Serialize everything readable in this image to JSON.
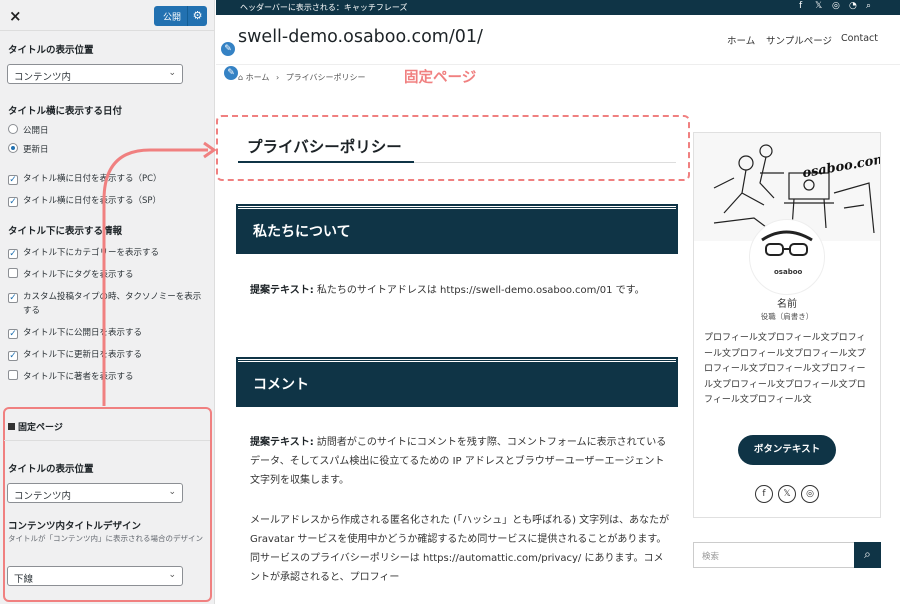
{
  "customizer": {
    "close_icon": "×",
    "publish_label": "公開",
    "gear_icon": "⚙",
    "title_position_heading": "タイトルの表示位置",
    "title_position_value": "コンテンツ内",
    "date_heading": "タイトル横に表示する日付",
    "date_options": [
      "公開日",
      "更新日"
    ],
    "date_selected": "更新日",
    "date_checkboxes": [
      "タイトル横に日付を表示する（PC）",
      "タイトル横に日付を表示する（SP）"
    ],
    "info_heading": "タイトル下に表示する情報",
    "info_checkboxes": [
      {
        "label": "タイトル下にカテゴリーを表示する",
        "checked": true
      },
      {
        "label": "タイトル下にタグを表示する",
        "checked": false
      },
      {
        "label": "カスタム投稿タイプの時、タクソノミーを表示する",
        "checked": true
      },
      {
        "label": "タイトル下に公開日を表示する",
        "checked": true
      },
      {
        "label": "タイトル下に更新日を表示する",
        "checked": true
      },
      {
        "label": "タイトル下に著者を表示する",
        "checked": false
      }
    ],
    "fixed_page_section": "固定ページ",
    "fixed_title_position_heading": "タイトルの表示位置",
    "fixed_title_position_value": "コンテンツ内",
    "fixed_title_design_heading": "コンテンツ内タイトルデザイン",
    "fixed_title_design_desc": "タイトルが「コンテンツ内」に表示される場合のデザイン",
    "fixed_title_design_value": "下線"
  },
  "site": {
    "topbar_text": "ヘッダーバーに表示される：キャッチフレーズ",
    "title": "swell-demo.osaboo.com/01/",
    "nav": [
      "ホーム",
      "サンプルページ",
      "Contact"
    ],
    "breadcrumb_home": "ホーム",
    "breadcrumb_sep": "›",
    "breadcrumb_current": "プライバシーポリシー",
    "annotation_label": "固定ページ",
    "page_title": "プライバシーポリシー",
    "sections": [
      {
        "heading": "私たちについて",
        "paragraphs": [
          {
            "bold": "提案テキスト:",
            "text": " 私たちのサイトアドレスは https://swell-demo.osaboo.com/01 です。"
          }
        ]
      },
      {
        "heading": "コメント",
        "paragraphs": [
          {
            "bold": "提案テキスト:",
            "text": " 訪問者がこのサイトにコメントを残す際、コメントフォームに表示されているデータ、そしてスパム検出に役立てるための IP アドレスとブラウザーユーザーエージェント文字列を収集します。"
          },
          {
            "bold": "",
            "text": "メールアドレスから作成される匿名化された (「ハッシュ」とも呼ばれる) 文字列は、あなたが Gravatar サービスを使用中かどうか確認するため同サービスに提供されることがあります。同サービスのプライバシーポリシーは https://automattic.com/privacy/ にあります。コメントが承認されると、プロフィー"
          }
        ]
      }
    ]
  },
  "widget": {
    "image_text": "osaboo.com",
    "avatar_text": "osaboo",
    "name": "名前",
    "role": "役職（肩書き）",
    "profile_text": "プロフィール文プロフィール文プロフィール文プロフィール文プロフィール文プロフィール文プロフィール文プロフィール文プロフィール文プロフィール文プロフィール文プロフィール文",
    "button_label": "ボタンテキスト",
    "social": [
      "facebook-icon",
      "x-icon",
      "instagram-icon"
    ]
  },
  "search": {
    "placeholder": "検索"
  },
  "colors": {
    "navy": "#0f3446",
    "highlight": "#f08080",
    "wp_blue": "#2271b1"
  }
}
